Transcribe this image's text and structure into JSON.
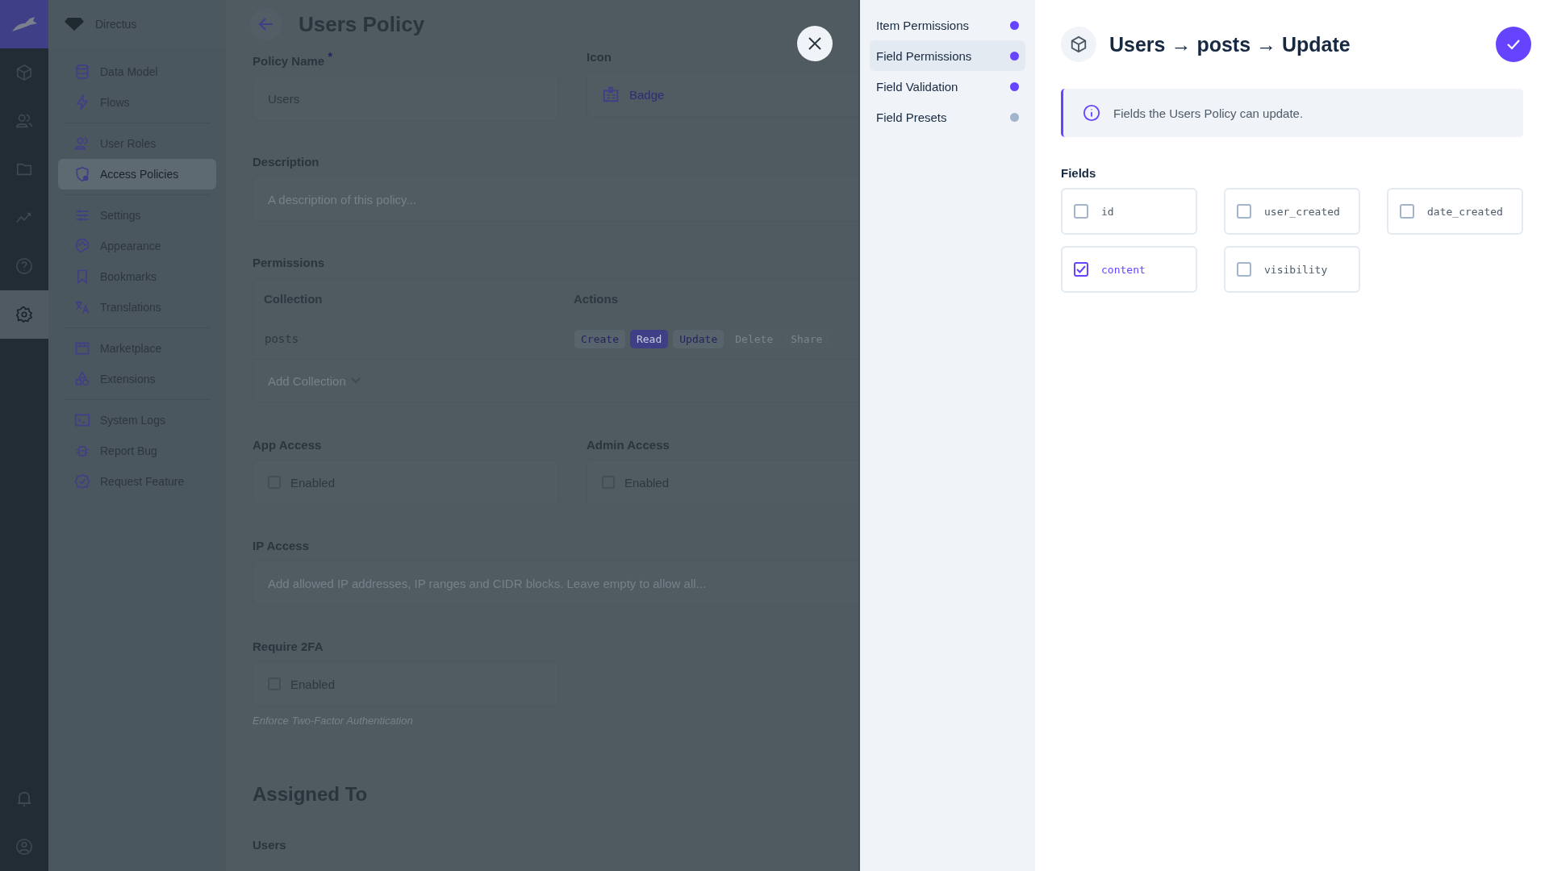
{
  "nav_rail": {
    "items": [
      {
        "selected": false
      },
      {
        "selected": false
      },
      {
        "selected": false
      },
      {
        "selected": false
      },
      {
        "selected": false
      },
      {
        "selected": true
      }
    ],
    "bottom": [
      {
        "selected": false
      },
      {
        "selected": false
      }
    ]
  },
  "sidebar": {
    "project": "Directus",
    "groups": [
      [
        {
          "label": "Data Model",
          "selected": false
        },
        {
          "label": "Flows",
          "selected": false
        }
      ],
      [
        {
          "label": "User Roles",
          "selected": false
        },
        {
          "label": "Access Policies",
          "selected": true
        }
      ],
      [
        {
          "label": "Settings",
          "selected": false
        },
        {
          "label": "Appearance",
          "selected": false
        },
        {
          "label": "Bookmarks",
          "selected": false
        },
        {
          "label": "Translations",
          "selected": false
        }
      ],
      [
        {
          "label": "Marketplace",
          "selected": false
        },
        {
          "label": "Extensions",
          "selected": false
        }
      ],
      [
        {
          "label": "System Logs",
          "selected": false
        },
        {
          "label": "Report Bug",
          "selected": false
        },
        {
          "label": "Request Feature",
          "selected": false
        }
      ]
    ]
  },
  "main": {
    "title": "Users Policy",
    "policy_name": {
      "label": "Policy Name",
      "required_mark": "*",
      "value": "Users"
    },
    "icon": {
      "label": "Icon",
      "value": "Badge"
    },
    "description": {
      "label": "Description",
      "placeholder": "A description of this policy..."
    },
    "permissions": {
      "label": "Permissions",
      "columns": [
        "Collection",
        "Actions"
      ],
      "rows": [
        {
          "collection": "posts",
          "actions": [
            {
              "label": "Create",
              "granted": true,
              "full": false
            },
            {
              "label": "Read",
              "granted": true,
              "full": true
            },
            {
              "label": "Update",
              "granted": true,
              "full": false
            },
            {
              "label": "Delete",
              "granted": false,
              "full": false
            },
            {
              "label": "Share",
              "granted": false,
              "full": false
            }
          ]
        }
      ],
      "add_collection": "Add Collection"
    },
    "app_access": {
      "label": "App Access",
      "option": "Enabled",
      "checked": false
    },
    "admin_access": {
      "label": "Admin Access",
      "option": "Enabled",
      "checked": false
    },
    "ip_access": {
      "label": "IP Access",
      "placeholder": "Add allowed IP addresses, IP ranges and CIDR blocks. Leave empty to allow all..."
    },
    "require_2fa": {
      "label": "Require 2FA",
      "option": "Enabled",
      "checked": false,
      "hint": "Enforce Two-Factor Authentication"
    },
    "assigned_heading": "Assigned To",
    "users_label": "Users"
  },
  "drawer": {
    "tabs": [
      {
        "label": "Item Permissions",
        "selected": false,
        "color": "#6644ff"
      },
      {
        "label": "Field Permissions",
        "selected": true,
        "color": "#6644ff"
      },
      {
        "label": "Field Validation",
        "selected": false,
        "color": "#6644ff"
      },
      {
        "label": "Field Presets",
        "selected": false,
        "color": "#a2b5cd"
      }
    ],
    "title": "Users → posts → Update",
    "notice": "Fields the Users Policy can update.",
    "fields_label": "Fields",
    "fields": [
      {
        "name": "id",
        "checked": false
      },
      {
        "name": "user_created",
        "checked": false
      },
      {
        "name": "date_created",
        "checked": false
      },
      {
        "name": "content",
        "checked": true
      },
      {
        "name": "visibility",
        "checked": false
      }
    ]
  }
}
